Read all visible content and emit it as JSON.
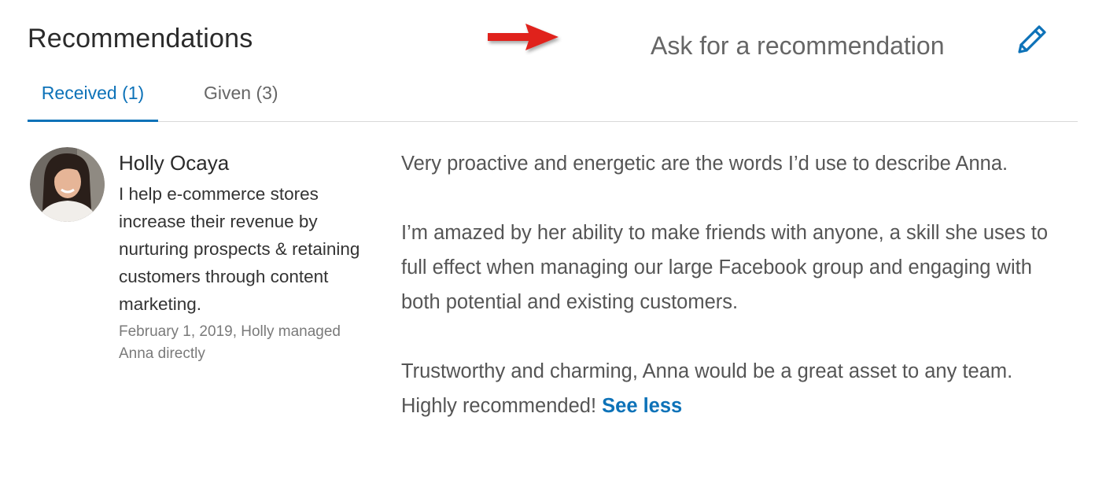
{
  "header": {
    "title": "Recommendations",
    "ask_link": "Ask for a recommendation",
    "arrow_color": "#e0201b",
    "edit_icon": "pencil-icon",
    "accent_color": "#0d72b8"
  },
  "tabs": [
    {
      "label": "Received (1)",
      "active": true
    },
    {
      "label": "Given (3)",
      "active": false
    }
  ],
  "recommendation": {
    "author_name": "Holly Ocaya",
    "author_headline": "I help e-commerce stores increase their revenue by nurturing prospects & retaining customers through content marketing.",
    "meta": "February 1, 2019, Holly managed Anna directly",
    "paragraphs": [
      "Very proactive and energetic are the words I’d use to describe Anna.",
      "I’m amazed by her ability to make friends with anyone, a skill she uses to full effect when managing our large Facebook group and engaging with both potential and existing customers.",
      "Trustworthy and charming, Anna would be a great asset to any team. Highly recommended!"
    ],
    "see_less": "See less"
  }
}
